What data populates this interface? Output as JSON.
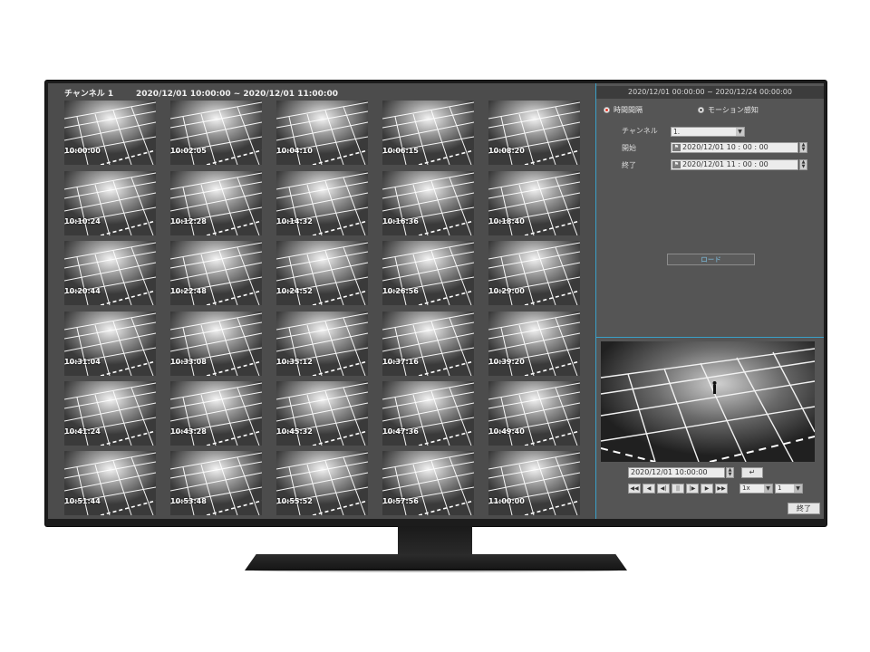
{
  "left_header": {
    "channel": "チャンネル 1",
    "range": "2020/12/01  10:00:00 ~ 2020/12/01  11:00:00"
  },
  "thumbnails": [
    "10:00:00",
    "10:02:05",
    "10:04:10",
    "10:06:15",
    "10:08:20",
    "10:10:24",
    "10:12:28",
    "10:14:32",
    "10:16:36",
    "10:18:40",
    "10:20:44",
    "10:22:48",
    "10:24:52",
    "10:26:56",
    "10:29:00",
    "10:31:04",
    "10:33:08",
    "10:35:12",
    "10:37:16",
    "10:39:20",
    "10:41:24",
    "10:43:28",
    "10:45:32",
    "10:47:36",
    "10:49:40",
    "10:51:44",
    "10:53:48",
    "10:55:52",
    "10:57:56",
    "11:00:00"
  ],
  "right_panel": {
    "header": "2020/12/01  00:00:00 ~ 2020/12/24  00:00:00",
    "radio_time": "時間間隔",
    "radio_motion": "モーション感知",
    "channel_label": "チャンネル",
    "channel_value": "1.",
    "start_label": "開始",
    "start_value": "2020/12/01  10 : 00 : 00",
    "end_label": "終了",
    "end_value": "2020/12/01  11 : 00 : 00",
    "load_button": "ロード",
    "playback_datetime": "2020/12/01  10:00:00",
    "speed_value": "1x",
    "step_value": "1 ",
    "exit_button": "終了"
  },
  "icons": {
    "enter": "↵",
    "rewind_fast": "◀◀",
    "rewind": "◀",
    "step_back": "◀|",
    "pause": "||",
    "step_forward": "|▶",
    "play": "▶",
    "forward_fast": "▶▶",
    "dropdown": "▼",
    "spin_up": "▲",
    "spin_down": "▼",
    "flag": "⚑"
  }
}
